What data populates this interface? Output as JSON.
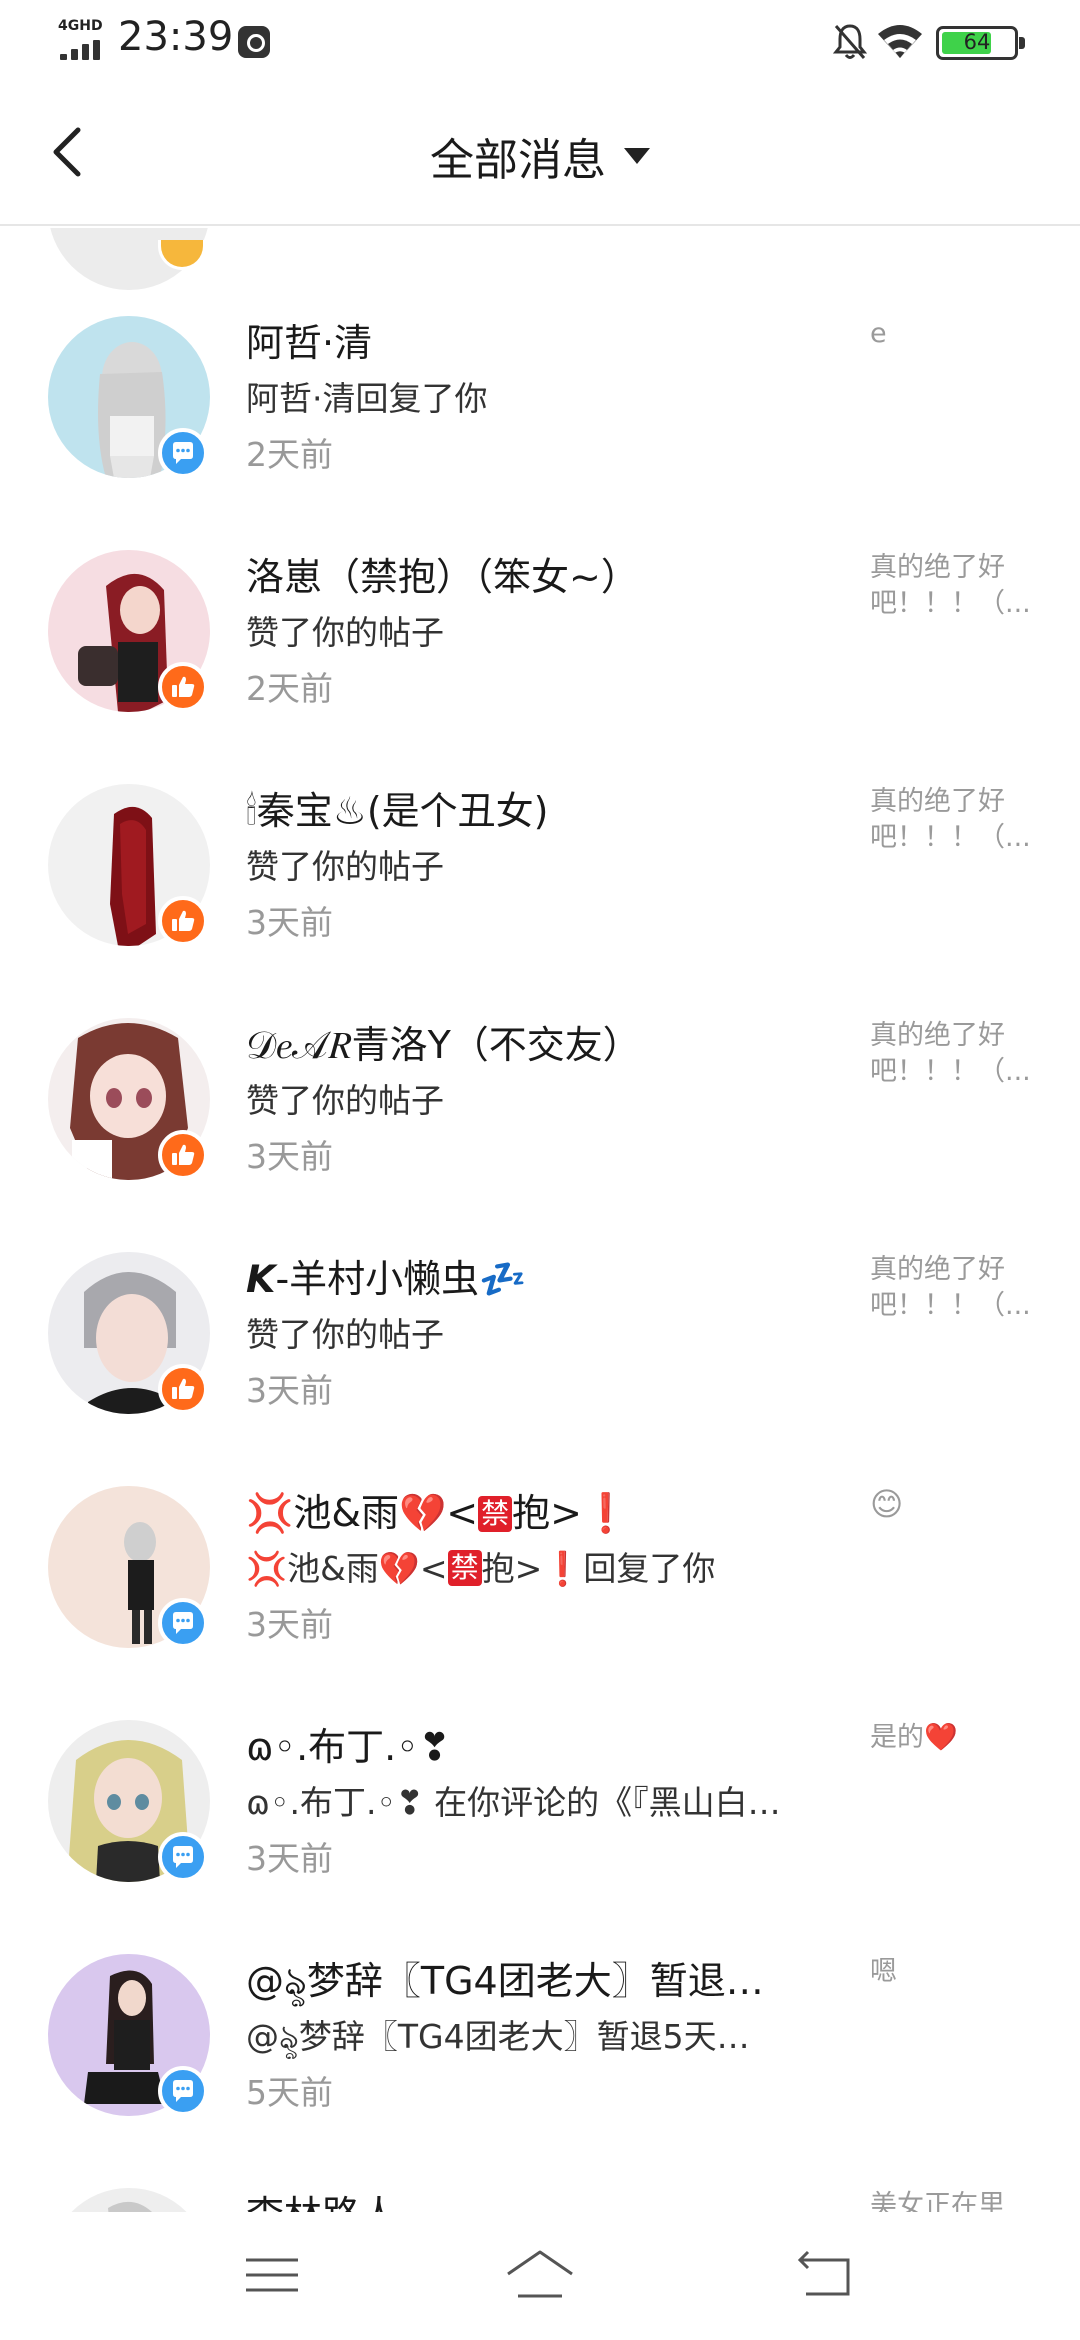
{
  "status_bar": {
    "network": "4GHD",
    "time": "23:39",
    "battery_percent": "64",
    "battery_level": 0.64,
    "icons": [
      "signal-icon",
      "app-notification-icon",
      "mute-icon",
      "wifi-icon",
      "battery-icon"
    ]
  },
  "header": {
    "title": "全部消息",
    "icons": [
      "back-arrow-icon",
      "dropdown-triangle-icon"
    ]
  },
  "colors": {
    "reply_badge": "#3a9ff2",
    "like_badge": "#ff6a1a",
    "time_text": "#999999",
    "preview_text": "#9a9a9a",
    "divider": "#e6e6e6"
  },
  "messages": [
    {
      "name": "阿哲·清",
      "desc": "阿哲·清回复了你",
      "time": "2天前",
      "preview": "e",
      "badge": "reply-icon"
    },
    {
      "name": "洛崽（禁抱）（笨女~）",
      "desc": "赞了你的帖子",
      "time": "2天前",
      "preview": "真的绝了好吧！！！（...",
      "badge": "like-icon"
    },
    {
      "name": "🕯秦宝♨(是个丑女)",
      "desc": "赞了你的帖子",
      "time": "3天前",
      "preview": "真的绝了好吧！！！（...",
      "badge": "like-icon"
    },
    {
      "name": "𝒟𝑒𝒜𝑅青洛Y（不交友）",
      "desc": "赞了你的帖子",
      "time": "3天前",
      "preview": "真的绝了好吧！！！（...",
      "badge": "like-icon"
    },
    {
      "name": "𝙆-羊村小懒虫💤",
      "desc": "赞了你的帖子",
      "time": "3天前",
      "preview": "真的绝了好吧！！！（...",
      "badge": "like-icon"
    },
    {
      "name_parts": [
        "💢池&雨💔<",
        "禁",
        "抱>",
        "❗"
      ],
      "desc_parts": [
        "💢池&雨💔<",
        "禁",
        "抱>",
        "❗",
        "回复了你"
      ],
      "time": "3天前",
      "preview": "😊",
      "badge": "reply-icon"
    },
    {
      "name": "ɷ◦.布丁.◦❣",
      "desc": "ɷ◦.布丁.◦❣ 在你评论的《『黑山白…",
      "time": "3天前",
      "preview": "是的❤️",
      "badge": "reply-icon"
    },
    {
      "name": "@ৡ梦辞〖TG4团老大〗暂退…",
      "desc": "@ৡ梦辞〖TG4团老大〗暂退5天…",
      "time": "5天前",
      "preview": "嗯",
      "badge": "reply-icon"
    },
    {
      "name": "李林路人",
      "preview": "美女正在里"
    }
  ],
  "bottom_nav": {
    "icons": [
      "menu-icon",
      "home-icon",
      "back-icon"
    ]
  }
}
